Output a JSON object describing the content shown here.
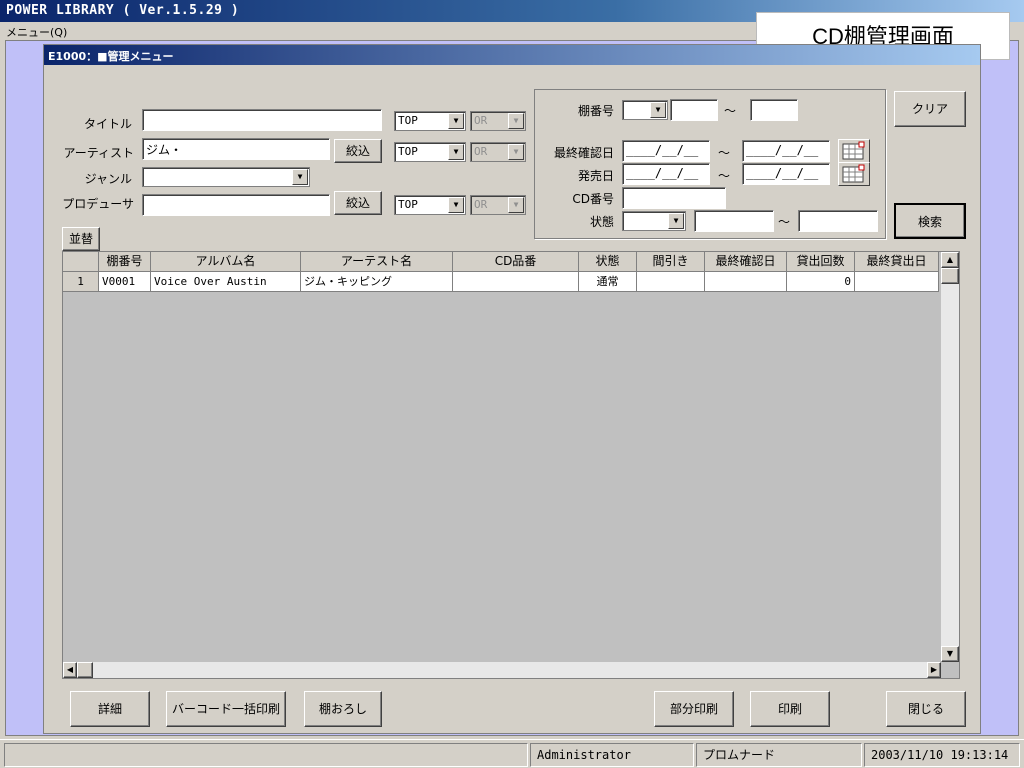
{
  "app": {
    "title": "POWER LIBRARY ( Ver.1.5.29 )",
    "menu": "メニュー(Q)",
    "caption": "CD棚管理画面"
  },
  "window": {
    "title": "E1000：■管理メニュー"
  },
  "search": {
    "title_label": "タイトル",
    "title_value": "",
    "artist_label": "アーティスト",
    "artist_value": "ジム・",
    "genre_label": "ジャンル",
    "genre_value": "",
    "producer_label": "プロデューサ",
    "producer_value": "",
    "filter_label": "絞込",
    "match_top": "TOP",
    "match_or": "OR",
    "shelf_label": "棚番号",
    "tilde": "～",
    "last_check_label": "最終確認日",
    "date_placeholder": "____/__/__",
    "release_label": "発売日",
    "cd_no_label": "CD番号",
    "cd_no_value": "",
    "status_label": "状態"
  },
  "buttons": {
    "clear": "クリア",
    "search": "検索",
    "sort": "並替",
    "detail": "詳細",
    "barcode_print": "バーコード一括印刷",
    "shelf_down": "棚おろし",
    "partial_print": "部分印刷",
    "print": "印刷",
    "close": "閉じる"
  },
  "table": {
    "columns": [
      "",
      "棚番号",
      "アルバム名",
      "アーテスト名",
      "CD品番",
      "状態",
      "間引き",
      "最終確認日",
      "貸出回数",
      "最終貸出日"
    ],
    "rows": [
      [
        "1",
        "V0001",
        "Voice Over Austin",
        "ジム・キッピング",
        "",
        "通常",
        "",
        "",
        "0",
        ""
      ]
    ]
  },
  "statusbar": {
    "user": "Administrator",
    "place": "プロムナード",
    "datetime": "2003/11/10 19:13:14"
  }
}
